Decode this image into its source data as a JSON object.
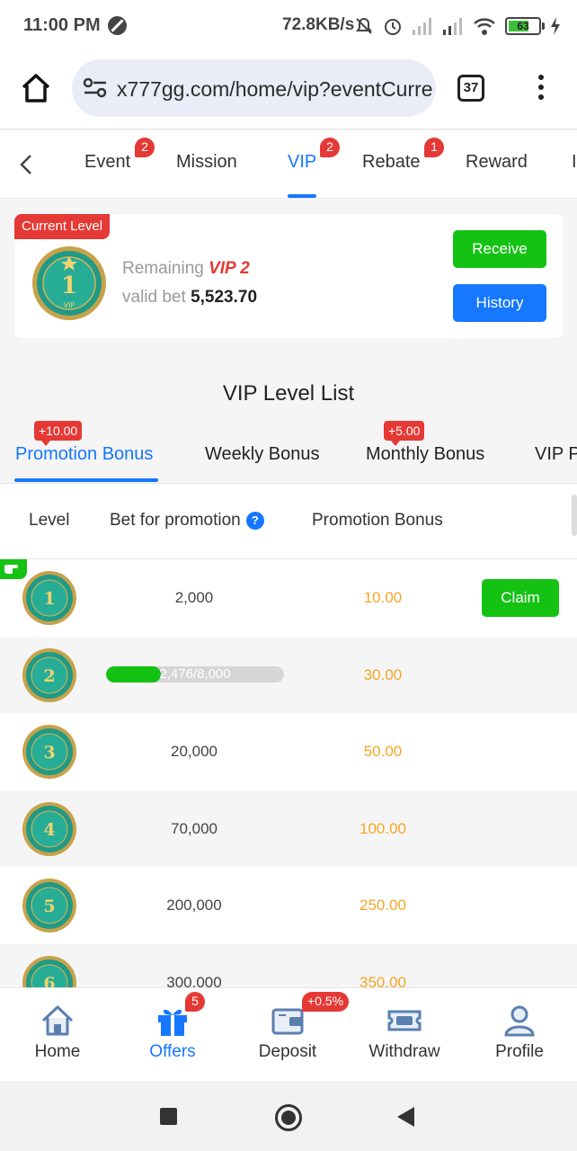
{
  "status_bar": {
    "time": "11:00 PM",
    "network_speed": "72.8KB/s",
    "battery": "63",
    "icons": [
      "do-not-disturb-icon",
      "mute-icon",
      "alarm-icon",
      "signal-icon",
      "signal-icon",
      "wifi-icon",
      "battery-icon",
      "charging-icon"
    ]
  },
  "browser": {
    "url": "x777gg.com/home/vip?eventCurre",
    "tab_count": "37"
  },
  "top_nav": {
    "items": [
      {
        "label": "Event",
        "badge": "2"
      },
      {
        "label": "Mission",
        "badge": ""
      },
      {
        "label": "VIP",
        "badge": "2",
        "active": true
      },
      {
        "label": "Rebate",
        "badge": "1"
      },
      {
        "label": "Reward",
        "badge": ""
      },
      {
        "label": "I",
        "badge": ""
      }
    ]
  },
  "current_level": {
    "tag": "Current Level",
    "level": "1",
    "medal_text": "VIP",
    "remaining_label": "Remaining",
    "next_vip": "VIP 2",
    "valid_bet_label": "valid bet",
    "valid_bet_value": "5,523.70",
    "receive_label": "Receive",
    "history_label": "History"
  },
  "vip_list": {
    "title": "VIP Level List",
    "tabs": [
      {
        "label": "Promotion Bonus",
        "badge": "+10.00",
        "active": true
      },
      {
        "label": "Weekly Bonus",
        "badge": ""
      },
      {
        "label": "Monthly Bonus",
        "badge": "+5.00"
      },
      {
        "label": "VIP P",
        "badge": ""
      }
    ],
    "columns": {
      "level": "Level",
      "bet": "Bet for promotion",
      "help": "?",
      "bonus": "Promotion Bonus"
    },
    "rows": [
      {
        "level": "1",
        "bet": "2,000",
        "bonus": "10.00",
        "action": "Claim"
      },
      {
        "level": "2",
        "bet": "",
        "progress_text": "2,476/8,000",
        "progress": 0.3095,
        "bonus": "30.00",
        "action": ""
      },
      {
        "level": "3",
        "bet": "20,000",
        "bonus": "50.00",
        "action": ""
      },
      {
        "level": "4",
        "bet": "70,000",
        "bonus": "100.00",
        "action": ""
      },
      {
        "level": "5",
        "bet": "200,000",
        "bonus": "250.00",
        "action": ""
      },
      {
        "level": "6",
        "bet": "300,000",
        "bonus": "350.00",
        "action": ""
      }
    ]
  },
  "bottom_nav": {
    "items": [
      {
        "label": "Home",
        "icon": "home-icon",
        "badge": ""
      },
      {
        "label": "Offers",
        "icon": "gift-icon",
        "badge": "5",
        "active": true
      },
      {
        "label": "Deposit",
        "icon": "wallet-icon",
        "badge": "+0.5%"
      },
      {
        "label": "Withdraw",
        "icon": "ticket-icon",
        "badge": ""
      },
      {
        "label": "Profile",
        "icon": "profile-icon",
        "badge": ""
      }
    ]
  },
  "colors": {
    "accent": "#1677ff",
    "success": "#14c214",
    "danger": "#e53935",
    "bonus": "#f5a623",
    "medal": "#1f9a86",
    "medal_ring": "#c8a24a"
  }
}
